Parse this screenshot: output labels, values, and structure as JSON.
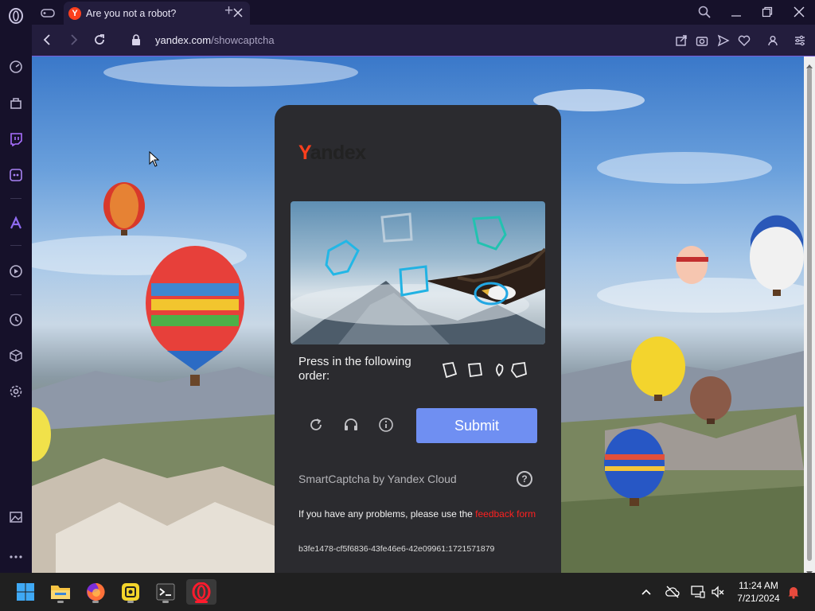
{
  "browser": {
    "tab_title": "Are you not a robot?",
    "url_domain": "yandex.com",
    "url_path": "/showcaptcha",
    "new_tab_symbol": "+"
  },
  "captcha": {
    "logo_text": "andex",
    "logo_first_letter": "Y",
    "instruction": "Press in the following order:",
    "submit_label": "Submit",
    "smartcaptcha_label": "SmartCaptcha by Yandex Cloud",
    "help_symbol": "?",
    "problems_text": "If you have any problems, please use the ",
    "feedback_link": "feedback form",
    "request_id": "b3fe1478-cf5f6836-43fe46e6-42e09961:1721571879"
  },
  "taskbar": {
    "time": "11:24 AM",
    "date": "7/21/2024"
  },
  "colors": {
    "accent": "#6f8ff2",
    "yandex_red": "#fc3f1d",
    "link_red": "#ff2020",
    "opera_red": "#ff1b2d"
  }
}
